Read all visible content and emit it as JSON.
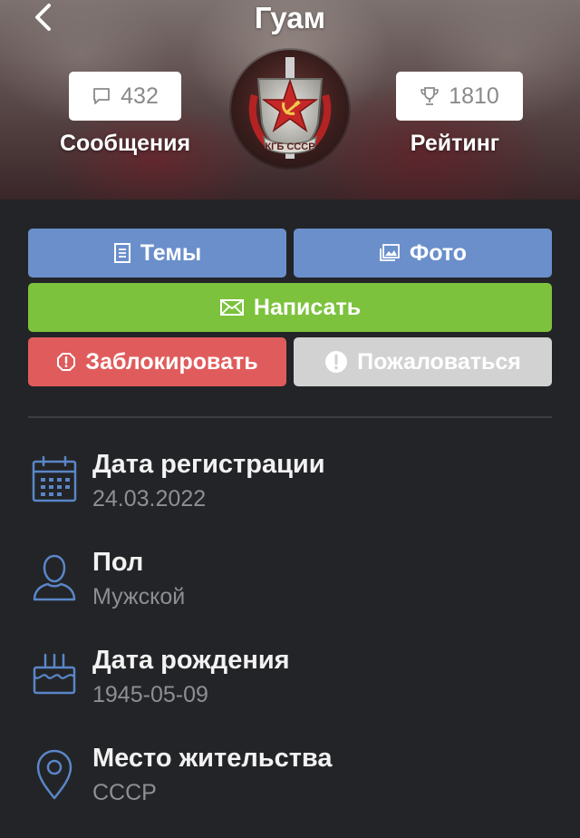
{
  "header": {
    "title": "Гуам",
    "messages": {
      "count": "432",
      "label": "Сообщения",
      "icon": "speech-bubble-icon"
    },
    "rating": {
      "count": "1810",
      "label": "Рейтинг",
      "icon": "trophy-icon"
    },
    "avatar": {
      "badge_text": "КГБ СССР"
    }
  },
  "actions": {
    "topics": "Темы",
    "photo": "Фото",
    "write": "Написать",
    "block": "Заблокировать",
    "report": "Пожаловаться"
  },
  "colors": {
    "blue": "#6a8fcb",
    "green": "#7cc23d",
    "red": "#e05c5c",
    "gray": "#d2d2d2",
    "icon_accent": "#5a86c7",
    "background": "#232427"
  },
  "info": [
    {
      "icon": "calendar-icon",
      "label": "Дата регистрации",
      "value": "24.03.2022"
    },
    {
      "icon": "person-icon",
      "label": "Пол",
      "value": "Мужской"
    },
    {
      "icon": "birthday-cake-icon",
      "label": "Дата рождения",
      "value": "1945-05-09"
    },
    {
      "icon": "location-pin-icon",
      "label": "Место жительства",
      "value": "СССР"
    }
  ]
}
